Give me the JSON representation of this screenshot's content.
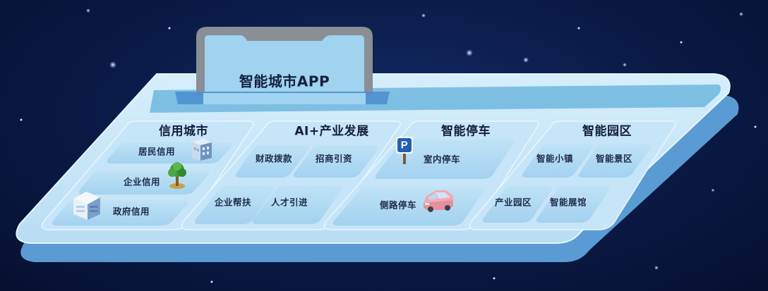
{
  "app": {
    "title": "智能城市APP"
  },
  "sections": [
    {
      "title": "信用城市",
      "items": [
        "居民信用",
        "企业信用",
        "政府信用"
      ]
    },
    {
      "title": "AI+产业发展",
      "items": [
        "财政拨款",
        "招商引资",
        "企业帮扶",
        "人才引进"
      ]
    },
    {
      "title": "智能停车",
      "items": [
        "室内停车",
        "侧路停车"
      ]
    },
    {
      "title": "智能园区",
      "items": [
        "智能小镇",
        "智能景区",
        "产业园区",
        "智能展馆"
      ]
    }
  ],
  "icons": {
    "building": "building-icon",
    "tree": "tree-icon",
    "government": "government-building-icon",
    "parking": "parking-sign-icon",
    "car": "car-icon"
  },
  "parking_sign_letter": "P",
  "colors": {
    "background": "#0a1a45",
    "platform_top": "#c9e6f8",
    "platform_side": "#5f9fd6",
    "tile": "#aed8f2",
    "phone_frame": "#8a8e95",
    "phone_screen": "#9fd3ef",
    "parking_sign": "#1f5fb8"
  }
}
